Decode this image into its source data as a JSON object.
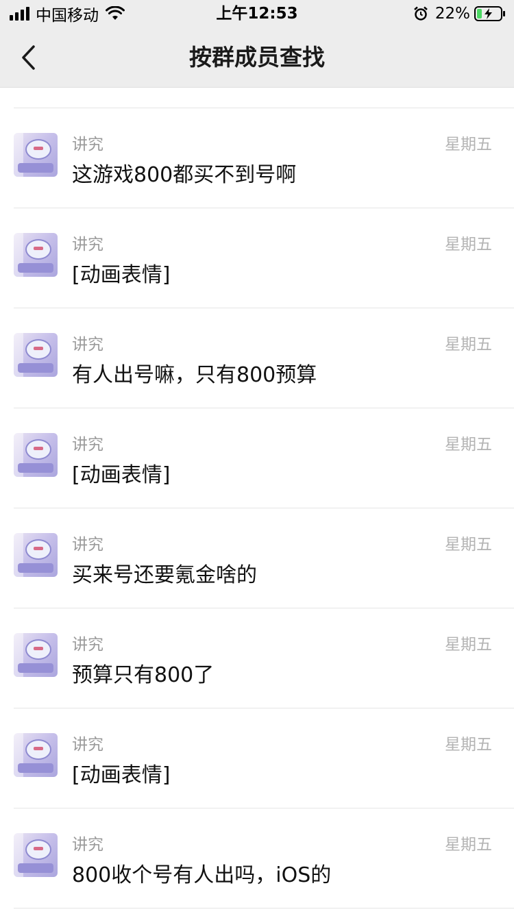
{
  "status_bar": {
    "carrier": "中国移动",
    "time": "上午12:53",
    "battery_percent": "22%",
    "battery_level": 0.22
  },
  "nav": {
    "title": "按群成员查找"
  },
  "messages": [
    {
      "sender": "讲究",
      "text": "这游戏800都买不到号啊",
      "time": "星期五"
    },
    {
      "sender": "讲究",
      "text": "[动画表情]",
      "time": "星期五"
    },
    {
      "sender": "讲究",
      "text": "有人出号嘛，只有800预算",
      "time": "星期五"
    },
    {
      "sender": "讲究",
      "text": "[动画表情]",
      "time": "星期五"
    },
    {
      "sender": "讲究",
      "text": "买来号还要氪金啥的",
      "time": "星期五"
    },
    {
      "sender": "讲究",
      "text": "预算只有800了",
      "time": "星期五"
    },
    {
      "sender": "讲究",
      "text": "[动画表情]",
      "time": "星期五"
    },
    {
      "sender": "讲究",
      "text": "800收个号有人出吗，iOS的",
      "time": "星期五"
    }
  ]
}
